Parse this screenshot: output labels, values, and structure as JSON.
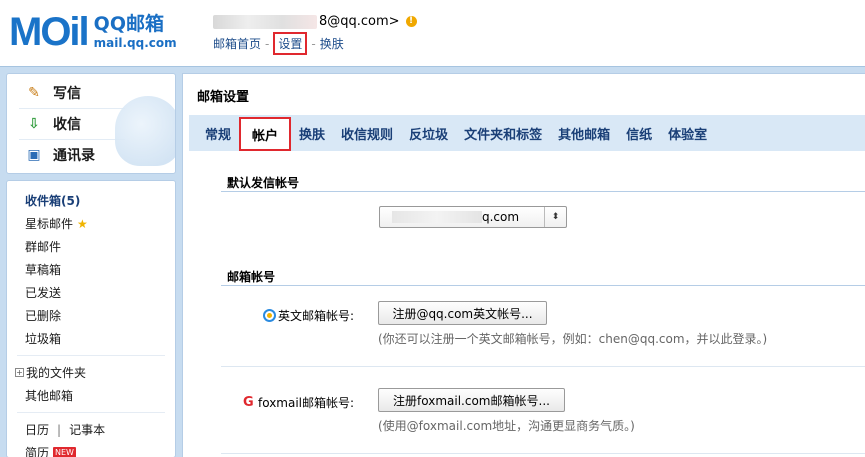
{
  "header": {
    "logo_mail": "MOil",
    "logo_qq": "QQ邮箱",
    "logo_url": "mail.qq.com",
    "account_suffix": "8@qq.com>",
    "warn_glyph": "!",
    "links": {
      "home": "邮箱首页",
      "settings": "设置",
      "skin": "换肤"
    },
    "link_separator": "-"
  },
  "quick_actions": [
    {
      "label": "写信",
      "icon": "pencil-paper-icon",
      "glyph": "✎"
    },
    {
      "label": "收信",
      "icon": "download-inbox-icon",
      "glyph": "⇩"
    },
    {
      "label": "通讯录",
      "icon": "contact-card-icon",
      "glyph": "▣"
    }
  ],
  "folders": {
    "inbox": "收件箱(5)",
    "starred": "星标邮件",
    "star_glyph": "★",
    "group": "群邮件",
    "drafts": "草稿箱",
    "sent": "已发送",
    "deleted": "已删除",
    "junk": "垃圾箱",
    "my_folders": "我的文件夹",
    "plus_glyph": "+",
    "other_mail": "其他邮箱",
    "calendar": "日历",
    "calendar_sep": "|",
    "notes": "记事本",
    "resume": "简历",
    "new_badge": "NEW"
  },
  "main": {
    "title": "邮箱设置",
    "tabs": [
      "常规",
      "帐户",
      "换肤",
      "收信规则",
      "反垃圾",
      "文件夹和标签",
      "其他邮箱",
      "信纸",
      "体验室"
    ],
    "active_tab": 1,
    "default_sender": {
      "heading": "默认发信帐号",
      "selected_value": "q.com",
      "arrow_glyph": "⬍"
    },
    "mail_accounts": {
      "heading": "邮箱帐号",
      "english_label": "英文邮箱帐号:",
      "english_button": "注册@qq.com英文帐号...",
      "english_hint": "(你还可以注册一个英文邮箱帐号，例如：chen@qq.com，并以此登录。)",
      "foxmail_label": "foxmail邮箱帐号:",
      "foxmail_button": "注册foxmail.com邮箱帐号...",
      "foxmail_hint": "(使用@foxmail.com地址，沟通更显商务气质。)"
    }
  },
  "colors": {
    "frame": "#c7dcf0",
    "tabbar": "#d9e8f6",
    "link": "#1e4d8b",
    "highlight": "#e0282e"
  }
}
